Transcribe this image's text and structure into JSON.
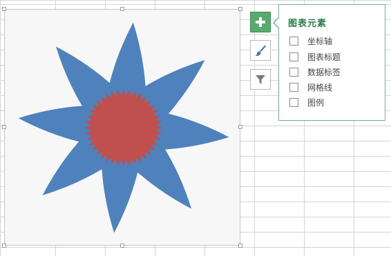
{
  "chart_elements_panel": {
    "title": "图表元素",
    "options": [
      {
        "label": "坐标轴",
        "checked": false
      },
      {
        "label": "图表标题",
        "checked": false
      },
      {
        "label": "数据标签",
        "checked": false
      },
      {
        "label": "网格线",
        "checked": false
      },
      {
        "label": "图例",
        "checked": false
      }
    ]
  },
  "side_buttons": [
    {
      "icon": "plus-icon",
      "active": true
    },
    {
      "icon": "paintbrush-icon",
      "active": false
    },
    {
      "icon": "filter-icon",
      "active": false
    }
  ],
  "colors": {
    "petals": "#4f81bd",
    "center": "#c0504d",
    "accent": "#5aaa6e",
    "gridline": "#d4d4d4"
  }
}
